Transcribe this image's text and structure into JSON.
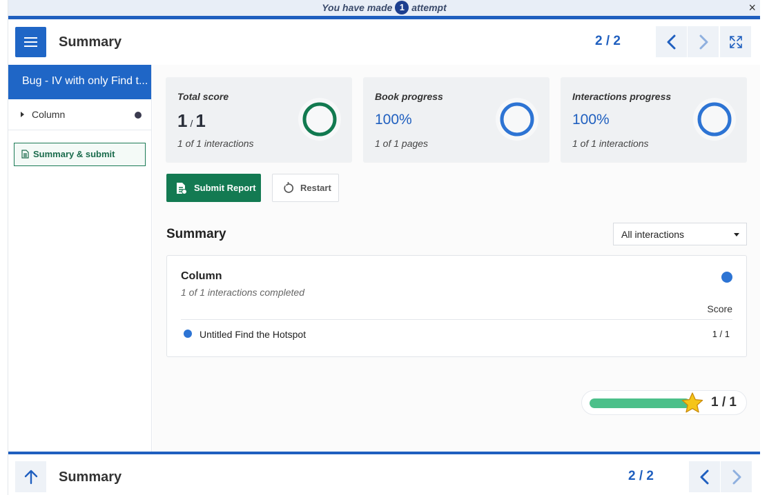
{
  "banner": {
    "text_before": "You have made",
    "attempt_count": "1",
    "text_after": "attempt",
    "close_glyph": "×"
  },
  "header": {
    "title": "Summary",
    "page_indicator": "2 / 2"
  },
  "sidebar": {
    "book_title": "Bug - IV with only Find t...",
    "chapters": [
      {
        "label": "Column"
      }
    ],
    "summary_link": "Summary & submit"
  },
  "cards": {
    "total_score": {
      "label": "Total score",
      "value": "1",
      "max": "1",
      "separator": "/",
      "sub": "1 of 1 interactions",
      "progress": 1.0,
      "color": "#127a50"
    },
    "book_progress": {
      "label": "Book progress",
      "value": "100%",
      "sub": "1 of 1 pages",
      "progress": 1.0,
      "color": "#2d74d4"
    },
    "interactions_progress": {
      "label": "Interactions progress",
      "value": "100%",
      "sub": "1 of 1 interactions",
      "progress": 1.0,
      "color": "#2d74d4"
    }
  },
  "actions": {
    "submit_label": "Submit Report",
    "restart_label": "Restart"
  },
  "summary": {
    "heading": "Summary",
    "filter_selected": "All interactions",
    "chapter_title": "Column",
    "chapter_sub": "1 of 1 interactions completed",
    "score_header": "Score",
    "rows": [
      {
        "name": "Untitled Find the Hotspot",
        "score": "1 / 1"
      }
    ]
  },
  "score_bar": {
    "fraction": 1.0,
    "label": "1 / 1"
  },
  "footer": {
    "title": "Summary",
    "page_indicator": "2 / 2"
  },
  "colors": {
    "primary": "#1f5fbf",
    "success": "#137a52",
    "bar_fill": "#4cc08a",
    "star": "#f5c518"
  },
  "icons": {
    "menu": "hamburger-menu-icon",
    "prev": "chevron-left-icon",
    "next": "chevron-right-icon",
    "fullscreen": "fullscreen-icon",
    "submit": "document-icon",
    "restart": "restart-icon",
    "star": "star-icon",
    "up": "arrow-up-icon"
  }
}
